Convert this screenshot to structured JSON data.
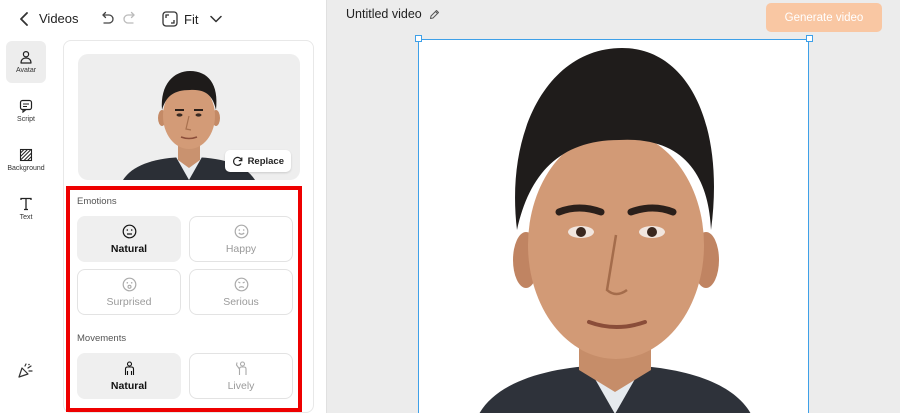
{
  "topbar": {
    "back_icon": "chevron-left-icon",
    "title": "Videos",
    "undo_icon": "undo-icon",
    "redo_icon": "redo-icon",
    "fit_label": "Fit",
    "fit_icon": "aspect-ratio-icon"
  },
  "rail": {
    "items": [
      {
        "label": "Avatar",
        "icon": "person-icon",
        "active": true
      },
      {
        "label": "Script",
        "icon": "chat-bubble-icon",
        "active": false
      },
      {
        "label": "Background",
        "icon": "hatch-pattern-icon",
        "active": false
      },
      {
        "label": "Text",
        "icon": "text-icon",
        "active": false
      }
    ],
    "bottom_icon": "celebration-icon"
  },
  "panel": {
    "replace_label": "Replace",
    "emotions_title": "Emotions",
    "emotions": [
      {
        "label": "Natural",
        "icon": "neutral-face-icon",
        "selected": true
      },
      {
        "label": "Happy",
        "icon": "smile-face-icon",
        "selected": false
      },
      {
        "label": "Surprised",
        "icon": "surprised-face-icon",
        "selected": false
      },
      {
        "label": "Serious",
        "icon": "serious-face-icon",
        "selected": false
      }
    ],
    "movements_title": "Movements",
    "movements": [
      {
        "label": "Natural",
        "icon": "standing-person-icon",
        "selected": true
      },
      {
        "label": "Lively",
        "icon": "waving-person-icon",
        "selected": false
      }
    ]
  },
  "canvas": {
    "video_title": "Untitled video",
    "edit_icon": "pencil-icon",
    "generate_label": "Generate video"
  },
  "colors": {
    "accent_disabled": "#f9c7a3",
    "selection_blue": "#3ea0e8",
    "highlight_red": "#ee0000"
  }
}
